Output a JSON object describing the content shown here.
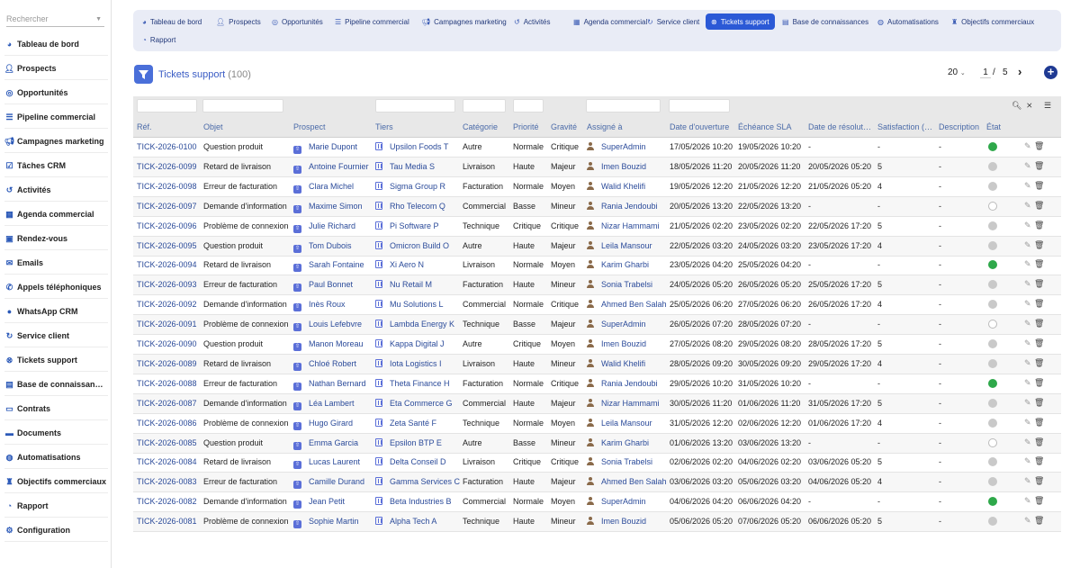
{
  "sidebar": {
    "search_placeholder": "Rechercher",
    "items": [
      {
        "label": "Tableau de bord",
        "icon": "dashboard-icon"
      },
      {
        "label": "Prospects",
        "icon": "user-plus-icon"
      },
      {
        "label": "Opportunités",
        "icon": "target-icon"
      },
      {
        "label": "Pipeline commercial",
        "icon": "pipeline-icon"
      },
      {
        "label": "Campagnes marketing",
        "icon": "megaphone-icon"
      },
      {
        "label": "Tâches CRM",
        "icon": "tasks-icon"
      },
      {
        "label": "Activités",
        "icon": "history-icon"
      },
      {
        "label": "Agenda commercial",
        "icon": "calendar-icon"
      },
      {
        "label": "Rendez-vous",
        "icon": "calendar-check-icon"
      },
      {
        "label": "Emails",
        "icon": "envelope-icon"
      },
      {
        "label": "Appels téléphoniques",
        "icon": "phone-icon"
      },
      {
        "label": "WhatsApp CRM",
        "icon": "chat-icon"
      },
      {
        "label": "Service client",
        "icon": "support-icon"
      },
      {
        "label": "Tickets support",
        "icon": "ticket-icon"
      },
      {
        "label": "Base de connaissan…",
        "icon": "book-icon"
      },
      {
        "label": "Contrats",
        "icon": "contract-icon"
      },
      {
        "label": "Documents",
        "icon": "folder-icon"
      },
      {
        "label": "Automatisations",
        "icon": "robot-icon"
      },
      {
        "label": "Objectifs commerciaux",
        "icon": "trophy-icon"
      },
      {
        "label": "Rapport",
        "icon": "chart-icon"
      },
      {
        "label": "Configuration",
        "icon": "gear-icon"
      }
    ]
  },
  "tabs": [
    {
      "label": "Tableau de bord",
      "icon": "dashboard-icon",
      "active": false
    },
    {
      "label": "Prospects",
      "icon": "user-plus-icon",
      "active": false
    },
    {
      "label": "Opportunités",
      "icon": "target-icon",
      "active": false
    },
    {
      "label": "Pipeline commercial",
      "icon": "pipeline-icon",
      "active": false
    },
    {
      "label": "Campagnes marketing",
      "icon": "megaphone-icon",
      "active": false
    },
    {
      "label": "Activités",
      "icon": "history-icon",
      "active": false
    },
    {
      "label": "Agenda commercial",
      "icon": "calendar-icon",
      "active": false
    },
    {
      "label": "Service client",
      "icon": "support-icon",
      "active": false
    },
    {
      "label": "Tickets support",
      "icon": "ticket-icon",
      "active": true
    },
    {
      "label": "Base de connaissances",
      "icon": "book-icon",
      "active": false
    },
    {
      "label": "Automatisations",
      "icon": "robot-icon",
      "active": false
    },
    {
      "label": "Objectifs commerciaux",
      "icon": "trophy-icon",
      "active": false
    },
    {
      "label": "Rapport",
      "icon": "chart-icon",
      "active": false
    }
  ],
  "page": {
    "title": "Tickets support",
    "count": "(100)",
    "page_size": "20",
    "current_page": "1",
    "separator": "/",
    "total_pages": "5"
  },
  "table": {
    "columns": [
      "Réf.",
      "Objet",
      "Prospect",
      "Tiers",
      "Catégorie",
      "Priorité",
      "Gravité",
      "Assigné à",
      "Date d'ouverture",
      "Échéance SLA",
      "Date de résolut…",
      "Satisfaction (…",
      "Description",
      "État"
    ],
    "rows": [
      {
        "ref": "TICK-2026-0100",
        "objet": "Question produit",
        "prospect": "Marie Dupont",
        "tiers": "Upsilon Foods T",
        "categorie": "Autre",
        "priorite": "Normale",
        "gravite": "Critique",
        "assigne": "SuperAdmin",
        "ouverture": "17/05/2026 10:20",
        "sla": "19/05/2026 10:20",
        "resolution": "-",
        "satisfaction": "-",
        "description": "-",
        "etat": "green"
      },
      {
        "ref": "TICK-2026-0099",
        "objet": "Retard de livraison",
        "prospect": "Antoine Fournier",
        "tiers": "Tau Media S",
        "categorie": "Livraison",
        "priorite": "Haute",
        "gravite": "Majeur",
        "assigne": "Imen Bouzid",
        "ouverture": "18/05/2026 11:20",
        "sla": "20/05/2026 11:20",
        "resolution": "20/05/2026 05:20",
        "satisfaction": "5",
        "description": "-",
        "etat": "gray"
      },
      {
        "ref": "TICK-2026-0098",
        "objet": "Erreur de facturation",
        "prospect": "Clara Michel",
        "tiers": "Sigma Group R",
        "categorie": "Facturation",
        "priorite": "Normale",
        "gravite": "Moyen",
        "assigne": "Walid Khelifi",
        "ouverture": "19/05/2026 12:20",
        "sla": "21/05/2026 12:20",
        "resolution": "21/05/2026 05:20",
        "satisfaction": "4",
        "description": "-",
        "etat": "gray"
      },
      {
        "ref": "TICK-2026-0097",
        "objet": "Demande d'information",
        "prospect": "Maxime Simon",
        "tiers": "Rho Telecom Q",
        "categorie": "Commercial",
        "priorite": "Basse",
        "gravite": "Mineur",
        "assigne": "Rania Jendoubi",
        "ouverture": "20/05/2026 13:20",
        "sla": "22/05/2026 13:20",
        "resolution": "-",
        "satisfaction": "-",
        "description": "-",
        "etat": "empty"
      },
      {
        "ref": "TICK-2026-0096",
        "objet": "Problème de connexion",
        "prospect": "Julie Richard",
        "tiers": "Pi Software P",
        "categorie": "Technique",
        "priorite": "Critique",
        "gravite": "Critique",
        "assigne": "Nizar Hammami",
        "ouverture": "21/05/2026 02:20",
        "sla": "23/05/2026 02:20",
        "resolution": "22/05/2026 17:20",
        "satisfaction": "5",
        "description": "-",
        "etat": "gray"
      },
      {
        "ref": "TICK-2026-0095",
        "objet": "Question produit",
        "prospect": "Tom Dubois",
        "tiers": "Omicron Build O",
        "categorie": "Autre",
        "priorite": "Haute",
        "gravite": "Majeur",
        "assigne": "Leila Mansour",
        "ouverture": "22/05/2026 03:20",
        "sla": "24/05/2026 03:20",
        "resolution": "23/05/2026 17:20",
        "satisfaction": "4",
        "description": "-",
        "etat": "gray"
      },
      {
        "ref": "TICK-2026-0094",
        "objet": "Retard de livraison",
        "prospect": "Sarah Fontaine",
        "tiers": "Xi Aero N",
        "categorie": "Livraison",
        "priorite": "Normale",
        "gravite": "Moyen",
        "assigne": "Karim Gharbi",
        "ouverture": "23/05/2026 04:20",
        "sla": "25/05/2026 04:20",
        "resolution": "-",
        "satisfaction": "-",
        "description": "-",
        "etat": "green"
      },
      {
        "ref": "TICK-2026-0093",
        "objet": "Erreur de facturation",
        "prospect": "Paul Bonnet",
        "tiers": "Nu Retail M",
        "categorie": "Facturation",
        "priorite": "Haute",
        "gravite": "Mineur",
        "assigne": "Sonia Trabelsi",
        "ouverture": "24/05/2026 05:20",
        "sla": "26/05/2026 05:20",
        "resolution": "25/05/2026 17:20",
        "satisfaction": "5",
        "description": "-",
        "etat": "gray"
      },
      {
        "ref": "TICK-2026-0092",
        "objet": "Demande d'information",
        "prospect": "Inès Roux",
        "tiers": "Mu Solutions L",
        "categorie": "Commercial",
        "priorite": "Normale",
        "gravite": "Critique",
        "assigne": "Ahmed Ben Salah",
        "ouverture": "25/05/2026 06:20",
        "sla": "27/05/2026 06:20",
        "resolution": "26/05/2026 17:20",
        "satisfaction": "4",
        "description": "-",
        "etat": "gray"
      },
      {
        "ref": "TICK-2026-0091",
        "objet": "Problème de connexion",
        "prospect": "Louis Lefebvre",
        "tiers": "Lambda Energy K",
        "categorie": "Technique",
        "priorite": "Basse",
        "gravite": "Majeur",
        "assigne": "SuperAdmin",
        "ouverture": "26/05/2026 07:20",
        "sla": "28/05/2026 07:20",
        "resolution": "-",
        "satisfaction": "-",
        "description": "-",
        "etat": "empty"
      },
      {
        "ref": "TICK-2026-0090",
        "objet": "Question produit",
        "prospect": "Manon Moreau",
        "tiers": "Kappa Digital J",
        "categorie": "Autre",
        "priorite": "Critique",
        "gravite": "Moyen",
        "assigne": "Imen Bouzid",
        "ouverture": "27/05/2026 08:20",
        "sla": "29/05/2026 08:20",
        "resolution": "28/05/2026 17:20",
        "satisfaction": "5",
        "description": "-",
        "etat": "gray"
      },
      {
        "ref": "TICK-2026-0089",
        "objet": "Retard de livraison",
        "prospect": "Chloé Robert",
        "tiers": "Iota Logistics I",
        "categorie": "Livraison",
        "priorite": "Haute",
        "gravite": "Mineur",
        "assigne": "Walid Khelifi",
        "ouverture": "28/05/2026 09:20",
        "sla": "30/05/2026 09:20",
        "resolution": "29/05/2026 17:20",
        "satisfaction": "4",
        "description": "-",
        "etat": "gray"
      },
      {
        "ref": "TICK-2026-0088",
        "objet": "Erreur de facturation",
        "prospect": "Nathan Bernard",
        "tiers": "Theta Finance H",
        "categorie": "Facturation",
        "priorite": "Normale",
        "gravite": "Critique",
        "assigne": "Rania Jendoubi",
        "ouverture": "29/05/2026 10:20",
        "sla": "31/05/2026 10:20",
        "resolution": "-",
        "satisfaction": "-",
        "description": "-",
        "etat": "green"
      },
      {
        "ref": "TICK-2026-0087",
        "objet": "Demande d'information",
        "prospect": "Léa Lambert",
        "tiers": "Eta Commerce G",
        "categorie": "Commercial",
        "priorite": "Haute",
        "gravite": "Majeur",
        "assigne": "Nizar Hammami",
        "ouverture": "30/05/2026 11:20",
        "sla": "01/06/2026 11:20",
        "resolution": "31/05/2026 17:20",
        "satisfaction": "5",
        "description": "-",
        "etat": "gray"
      },
      {
        "ref": "TICK-2026-0086",
        "objet": "Problème de connexion",
        "prospect": "Hugo Girard",
        "tiers": "Zeta Santé F",
        "categorie": "Technique",
        "priorite": "Normale",
        "gravite": "Moyen",
        "assigne": "Leila Mansour",
        "ouverture": "31/05/2026 12:20",
        "sla": "02/06/2026 12:20",
        "resolution": "01/06/2026 17:20",
        "satisfaction": "4",
        "description": "-",
        "etat": "gray"
      },
      {
        "ref": "TICK-2026-0085",
        "objet": "Question produit",
        "prospect": "Emma Garcia",
        "tiers": "Epsilon BTP E",
        "categorie": "Autre",
        "priorite": "Basse",
        "gravite": "Mineur",
        "assigne": "Karim Gharbi",
        "ouverture": "01/06/2026 13:20",
        "sla": "03/06/2026 13:20",
        "resolution": "-",
        "satisfaction": "-",
        "description": "-",
        "etat": "empty"
      },
      {
        "ref": "TICK-2026-0084",
        "objet": "Retard de livraison",
        "prospect": "Lucas Laurent",
        "tiers": "Delta Conseil D",
        "categorie": "Livraison",
        "priorite": "Critique",
        "gravite": "Critique",
        "assigne": "Sonia Trabelsi",
        "ouverture": "02/06/2026 02:20",
        "sla": "04/06/2026 02:20",
        "resolution": "03/06/2026 05:20",
        "satisfaction": "5",
        "description": "-",
        "etat": "gray"
      },
      {
        "ref": "TICK-2026-0083",
        "objet": "Erreur de facturation",
        "prospect": "Camille Durand",
        "tiers": "Gamma Services C",
        "categorie": "Facturation",
        "priorite": "Haute",
        "gravite": "Majeur",
        "assigne": "Ahmed Ben Salah",
        "ouverture": "03/06/2026 03:20",
        "sla": "05/06/2026 03:20",
        "resolution": "04/06/2026 05:20",
        "satisfaction": "4",
        "description": "-",
        "etat": "gray"
      },
      {
        "ref": "TICK-2026-0082",
        "objet": "Demande d'information",
        "prospect": "Jean Petit",
        "tiers": "Beta Industries B",
        "categorie": "Commercial",
        "priorite": "Normale",
        "gravite": "Moyen",
        "assigne": "SuperAdmin",
        "ouverture": "04/06/2026 04:20",
        "sla": "06/06/2026 04:20",
        "resolution": "-",
        "satisfaction": "-",
        "description": "-",
        "etat": "green"
      },
      {
        "ref": "TICK-2026-0081",
        "objet": "Problème de connexion",
        "prospect": "Sophie Martin",
        "tiers": "Alpha Tech A",
        "categorie": "Technique",
        "priorite": "Haute",
        "gravite": "Mineur",
        "assigne": "Imen Bouzid",
        "ouverture": "05/06/2026 05:20",
        "sla": "07/06/2026 05:20",
        "resolution": "06/06/2026 05:20",
        "satisfaction": "5",
        "description": "-",
        "etat": "gray"
      }
    ]
  },
  "colors": {
    "accent": "#2b59d6",
    "link": "#2b4b9a",
    "state_open": "#2ea84a",
    "state_closed": "#c9c9c9"
  }
}
